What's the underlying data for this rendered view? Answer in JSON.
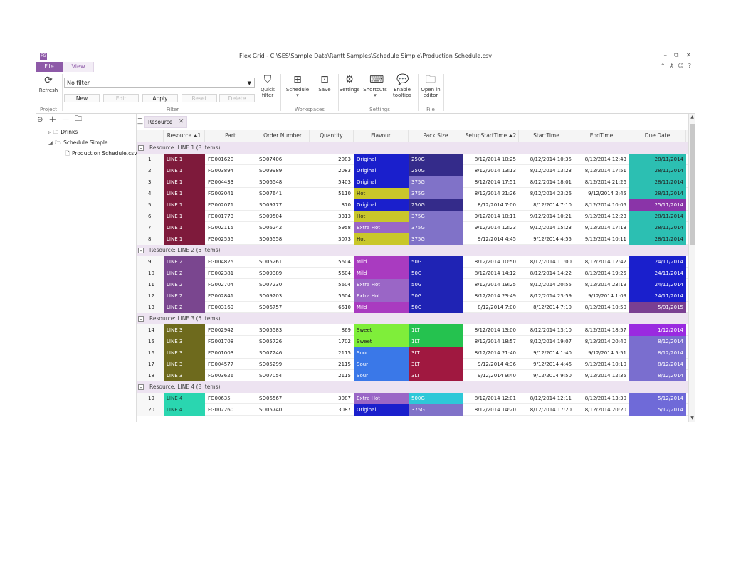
{
  "window": {
    "title": "Flex Grid - C:\\SES\\Sample Data\\Rantt Samples\\Schedule Simple\\Production Schedule.csv",
    "logo": "FG",
    "minimize": "–",
    "restore": "⧉",
    "close": "✕"
  },
  "tabs": {
    "file": "File",
    "view": "View"
  },
  "ribbon_icons": {
    "up": "⌃",
    "key": "⚷",
    "smile": "☺",
    "help": "?"
  },
  "ribbon": {
    "refresh_label": "Refresh",
    "project_group": "Project",
    "filter_value": "No filter",
    "new_label": "New",
    "edit_label": "Edit",
    "apply_label": "Apply",
    "reset_label": "Reset",
    "delete_label": "Delete",
    "filter_group": "Filter",
    "quick_filter_l1": "Quick",
    "quick_filter_l2": "filter",
    "schedule_label": "Schedule",
    "schedule_caret": "▾",
    "save_label": "Save",
    "workspaces_group": "Workspaces",
    "settings_label": "Settings",
    "shortcuts_label": "Shortcuts",
    "shortcuts_caret": "▾",
    "enable_l1": "Enable",
    "enable_l2": "tooltips",
    "settings_group": "Settings",
    "open_l1": "Open in",
    "open_l2": "editor",
    "file_group": "File"
  },
  "tree": {
    "items": [
      {
        "label": "Drinks"
      },
      {
        "label": "Schedule Simple"
      },
      {
        "label": "Production Schedule.csv"
      }
    ]
  },
  "grouping": {
    "chip_label": "Resource",
    "chip_close": "✕"
  },
  "columns": [
    "",
    "Resource ⏶1",
    "Part",
    "Order Number",
    "Quantity",
    "Flavour",
    "Pack Size",
    "SetupStartTime ⏶2",
    "StartTime",
    "EndTime",
    "Due Date"
  ],
  "groups": [
    {
      "label": "Resource: LINE 1 (8 items)",
      "rows": [
        [
          "1",
          "LINE 1",
          "FG001620",
          "SO07406",
          "2083",
          "Original",
          "250G",
          "8/12/2014 10:25",
          "8/12/2014 10:35",
          "8/12/2014 12:43",
          "28/11/2014"
        ],
        [
          "2",
          "LINE 1",
          "FG003894",
          "SO09989",
          "2083",
          "Original",
          "250G",
          "8/12/2014 13:13",
          "8/12/2014 13:23",
          "8/12/2014 17:51",
          "28/11/2014"
        ],
        [
          "3",
          "LINE 1",
          "FG004433",
          "SO06548",
          "5403",
          "Original",
          "375G",
          "8/12/2014 17:51",
          "8/12/2014 18:01",
          "8/12/2014 21:26",
          "28/11/2014"
        ],
        [
          "4",
          "LINE 1",
          "FG003041",
          "SO07641",
          "5110",
          "Hot",
          "375G",
          "8/12/2014 21:26",
          "8/12/2014 23:26",
          "9/12/2014 2:45",
          "28/11/2014"
        ],
        [
          "5",
          "LINE 1",
          "FG002071",
          "SO09777",
          "370",
          "Original",
          "250G",
          "8/12/2014 7:00",
          "8/12/2014 7:10",
          "8/12/2014 10:05",
          "25/11/2014"
        ],
        [
          "6",
          "LINE 1",
          "FG001773",
          "SO09504",
          "3313",
          "Hot",
          "375G",
          "9/12/2014 10:11",
          "9/12/2014 10:21",
          "9/12/2014 12:23",
          "28/11/2014"
        ],
        [
          "7",
          "LINE 1",
          "FG002115",
          "SO06242",
          "5958",
          "Extra Hot",
          "375G",
          "9/12/2014 12:23",
          "9/12/2014 15:23",
          "9/12/2014 17:13",
          "28/11/2014"
        ],
        [
          "8",
          "LINE 1",
          "FG002555",
          "SO05558",
          "3073",
          "Hot",
          "375G",
          "9/12/2014 4:45",
          "9/12/2014 4:55",
          "9/12/2014 10:11",
          "28/11/2014"
        ]
      ]
    },
    {
      "label": "Resource: LINE 2 (5 items)",
      "rows": [
        [
          "9",
          "LINE 2",
          "FG004825",
          "SO05261",
          "5604",
          "Mild",
          "50G",
          "8/12/2014 10:50",
          "8/12/2014 11:00",
          "8/12/2014 12:42",
          "24/11/2014"
        ],
        [
          "10",
          "LINE 2",
          "FG002381",
          "SO09389",
          "5604",
          "Mild",
          "50G",
          "8/12/2014 14:12",
          "8/12/2014 14:22",
          "8/12/2014 19:25",
          "24/11/2014"
        ],
        [
          "11",
          "LINE 2",
          "FG002704",
          "SO07230",
          "5604",
          "Extra Hot",
          "50G",
          "8/12/2014 19:25",
          "8/12/2014 20:55",
          "8/12/2014 23:19",
          "24/11/2014"
        ],
        [
          "12",
          "LINE 2",
          "FG002841",
          "SO09203",
          "5604",
          "Extra Hot",
          "50G",
          "8/12/2014 23:49",
          "8/12/2014 23:59",
          "9/12/2014 1:09",
          "24/11/2014"
        ],
        [
          "13",
          "LINE 2",
          "FG003169",
          "SO06757",
          "6510",
          "Mild",
          "50G",
          "8/12/2014 7:00",
          "8/12/2014 7:10",
          "8/12/2014 10:50",
          "5/01/2015"
        ]
      ]
    },
    {
      "label": "Resource: LINE 3 (5 items)",
      "rows": [
        [
          "14",
          "LINE 3",
          "FG002942",
          "SO05583",
          "869",
          "Sweet",
          "1LT",
          "8/12/2014 13:00",
          "8/12/2014 13:10",
          "8/12/2014 18:57",
          "1/12/2014"
        ],
        [
          "15",
          "LINE 3",
          "FG001708",
          "SO05726",
          "1702",
          "Sweet",
          "1LT",
          "8/12/2014 18:57",
          "8/12/2014 19:07",
          "8/12/2014 20:40",
          "8/12/2014"
        ],
        [
          "16",
          "LINE 3",
          "FG001003",
          "SO07246",
          "2115",
          "Sour",
          "3LT",
          "8/12/2014 21:40",
          "9/12/2014 1:40",
          "9/12/2014 5:51",
          "8/12/2014"
        ],
        [
          "17",
          "LINE 3",
          "FG004577",
          "SO05299",
          "2115",
          "Sour",
          "3LT",
          "9/12/2014 4:36",
          "9/12/2014 4:46",
          "9/12/2014 10:10",
          "8/12/2014"
        ],
        [
          "18",
          "LINE 3",
          "FG003626",
          "SO07054",
          "2115",
          "Sour",
          "3LT",
          "9/12/2014 9:40",
          "9/12/2014 9:50",
          "9/12/2014 12:35",
          "8/12/2014"
        ]
      ]
    },
    {
      "label": "Resource: LINE 4 (8 items)",
      "rows": [
        [
          "19",
          "LINE 4",
          "FG00635",
          "SO06567",
          "3087",
          "Extra Hot",
          "500G",
          "8/12/2014 12:01",
          "8/12/2014 12:11",
          "8/12/2014 13:30",
          "5/12/2014"
        ],
        [
          "20",
          "LINE 4",
          "FG002260",
          "SO05740",
          "3087",
          "Original",
          "375G",
          "8/12/2014 14:20",
          "8/12/2014 17:20",
          "8/12/2014 20:20",
          "5/12/2014"
        ]
      ]
    }
  ],
  "colors": {
    "resource": {
      "LINE 1": "#7e1a3b",
      "LINE 2": "#7a468f",
      "LINE 3": "#6e6a1d",
      "LINE 4": "#2ad6b0"
    },
    "flavour": {
      "Original": "#1a1fcc",
      "Hot": "#c9c72a",
      "Extra Hot": "#9a66c6",
      "Mild": "#a93bc0",
      "Sweet": "#7fee3a",
      "Sour": "#3a78e8"
    },
    "pack": {
      "250G": "#342b8a",
      "375G": "#8072c8",
      "50G": "#1f23b4",
      "1LT": "#25c24f",
      "3LT": "#a01840",
      "500G": "#2ec8d8"
    },
    "due": {
      "28/11/2014": "#2cbfb2",
      "25/11/2014": "#8a34a8",
      "24/11/2014": "#1a1fcc",
      "5/01/2015": "#7a3f92",
      "1/12/2014": "#9a2ae0",
      "8/12/2014": "#7a6ecf",
      "5/12/2014": "#6f6ad8"
    },
    "accent": "#8e5aa8",
    "group_row": "#ede3f1"
  }
}
